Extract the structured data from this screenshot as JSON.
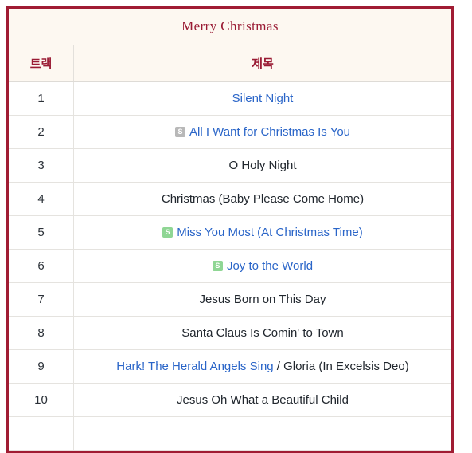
{
  "album": {
    "title": "Merry Christmas"
  },
  "table": {
    "headers": {
      "track": "트랙",
      "title": "제목"
    },
    "rows": [
      {
        "track": "1",
        "badge": null,
        "link_text": "Silent Night",
        "plain_text": ""
      },
      {
        "track": "2",
        "badge": {
          "label": "S",
          "color": "#b8b8b8",
          "kind": "single-gray"
        },
        "link_text": "All I Want for Christmas Is You",
        "plain_text": ""
      },
      {
        "track": "3",
        "badge": null,
        "link_text": "",
        "plain_text": "O Holy Night"
      },
      {
        "track": "4",
        "badge": null,
        "link_text": "",
        "plain_text": "Christmas (Baby Please Come Home)"
      },
      {
        "track": "5",
        "badge": {
          "label": "S",
          "color": "#8fd694",
          "kind": "single-green"
        },
        "link_text": "Miss You Most (At Christmas Time)",
        "plain_text": ""
      },
      {
        "track": "6",
        "badge": {
          "label": "S",
          "color": "#8fd694",
          "kind": "single-green"
        },
        "link_text": "Joy to the World",
        "plain_text": ""
      },
      {
        "track": "7",
        "badge": null,
        "link_text": "",
        "plain_text": "Jesus Born on This Day"
      },
      {
        "track": "8",
        "badge": null,
        "link_text": "",
        "plain_text": "Santa Claus Is Comin' to Town"
      },
      {
        "track": "9",
        "badge": null,
        "link_text": "Hark! The Herald Angels Sing",
        "plain_text": " / Gloria (In Excelsis Deo)"
      },
      {
        "track": "10",
        "badge": null,
        "link_text": "",
        "plain_text": "Jesus Oh What a Beautiful Child"
      },
      {
        "track": "",
        "badge": null,
        "link_text": "",
        "plain_text": ""
      }
    ]
  },
  "colors": {
    "border": "#a01c33",
    "header_text": "#9a1b34",
    "header_bg": "#fdf8f1",
    "link": "#2a65c8",
    "body_text": "#21272e"
  }
}
